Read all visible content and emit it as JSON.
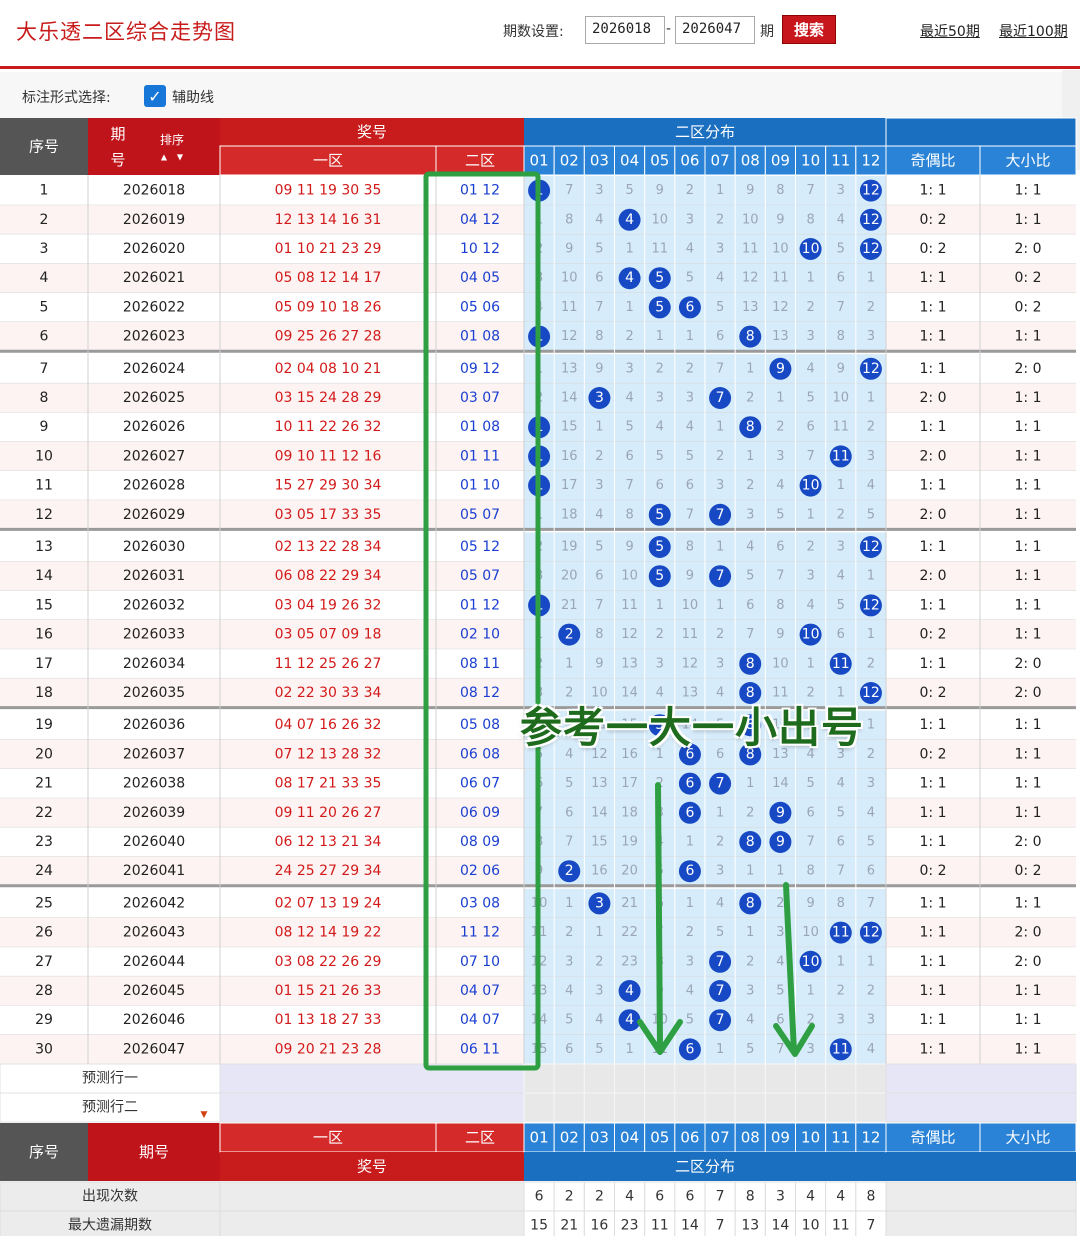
{
  "header": {
    "title": "大乐透二区综合走势图",
    "period_label": "期数设置:",
    "start_period": "2026018",
    "end_period": "2026047",
    "period_suffix": "期",
    "search_label": "搜索",
    "recent50_label": "最近50期",
    "recent100_label": "最近100期"
  },
  "mark_options": {
    "label": "标注形式选择:",
    "checkbox_label": "辅助线",
    "checked": true
  },
  "table": {
    "col_seq": "序号",
    "col_period": "期号",
    "col_period_top": "期",
    "col_period_bottom": "号",
    "sort_label": "排序",
    "col_prize": "奖号",
    "col_zone1": "一区",
    "col_zone2": "二区",
    "col_dist": "二区分布",
    "dist_numbers": [
      "01",
      "02",
      "03",
      "04",
      "05",
      "06",
      "07",
      "08",
      "09",
      "10",
      "11",
      "12"
    ],
    "col_odd_even": "奇偶比",
    "col_big_small": "大小比",
    "rows": [
      {
        "seq": "1",
        "period": "2026018",
        "zone1": "09 11 19 30 35",
        "zone2": "01 12",
        "cells": [
          "1",
          "7",
          "3",
          "5",
          "9",
          "2",
          "1",
          "9",
          "8",
          "7",
          "3",
          "12"
        ],
        "hit": [
          1,
          12
        ],
        "oe": "1: 1",
        "bs": "1: 1"
      },
      {
        "seq": "2",
        "period": "2026019",
        "zone1": "12 13 14 16 31",
        "zone2": "04 12",
        "cells": [
          "1",
          "8",
          "4",
          "4",
          "10",
          "3",
          "2",
          "10",
          "9",
          "8",
          "4",
          "12"
        ],
        "hit": [
          4,
          12
        ],
        "oe": "0: 2",
        "bs": "1: 1"
      },
      {
        "seq": "3",
        "period": "2026020",
        "zone1": "01 10 21 23 29",
        "zone2": "10 12",
        "cells": [
          "2",
          "9",
          "5",
          "1",
          "11",
          "4",
          "3",
          "11",
          "10",
          "10",
          "5",
          "12"
        ],
        "hit": [
          10,
          12
        ],
        "oe": "0: 2",
        "bs": "2: 0"
      },
      {
        "seq": "4",
        "period": "2026021",
        "zone1": "05 08 12 14 17",
        "zone2": "04 05",
        "cells": [
          "3",
          "10",
          "6",
          "4",
          "5",
          "5",
          "4",
          "12",
          "11",
          "1",
          "6",
          "1"
        ],
        "hit": [
          4,
          5
        ],
        "oe": "1: 1",
        "bs": "0: 2"
      },
      {
        "seq": "5",
        "period": "2026022",
        "zone1": "05 09 10 18 26",
        "zone2": "05 06",
        "cells": [
          "4",
          "11",
          "7",
          "1",
          "5",
          "6",
          "5",
          "13",
          "12",
          "2",
          "7",
          "2"
        ],
        "hit": [
          5,
          6
        ],
        "oe": "1: 1",
        "bs": "0: 2"
      },
      {
        "seq": "6",
        "period": "2026023",
        "zone1": "09 25 26 27 28",
        "zone2": "01 08",
        "cells": [
          "1",
          "12",
          "8",
          "2",
          "1",
          "1",
          "6",
          "8",
          "13",
          "3",
          "8",
          "3"
        ],
        "hit": [
          1,
          8
        ],
        "oe": "1: 1",
        "bs": "1: 1"
      },
      {
        "seq": "7",
        "period": "2026024",
        "zone1": "02 04 08 10 21",
        "zone2": "09 12",
        "cells": [
          "1",
          "13",
          "9",
          "3",
          "2",
          "2",
          "7",
          "1",
          "9",
          "4",
          "9",
          "12"
        ],
        "hit": [
          9,
          12
        ],
        "oe": "1: 1",
        "bs": "2: 0"
      },
      {
        "seq": "8",
        "period": "2026025",
        "zone1": "03 15 24 28 29",
        "zone2": "03 07",
        "cells": [
          "2",
          "14",
          "3",
          "4",
          "3",
          "3",
          "7",
          "2",
          "1",
          "5",
          "10",
          "1"
        ],
        "hit": [
          3,
          7
        ],
        "oe": "2: 0",
        "bs": "1: 1"
      },
      {
        "seq": "9",
        "period": "2026026",
        "zone1": "10 11 22 26 32",
        "zone2": "01 08",
        "cells": [
          "1",
          "15",
          "1",
          "5",
          "4",
          "4",
          "1",
          "8",
          "2",
          "6",
          "11",
          "2"
        ],
        "hit": [
          1,
          8
        ],
        "oe": "1: 1",
        "bs": "1: 1"
      },
      {
        "seq": "10",
        "period": "2026027",
        "zone1": "09 10 11 12 16",
        "zone2": "01 11",
        "cells": [
          "1",
          "16",
          "2",
          "6",
          "5",
          "5",
          "2",
          "1",
          "3",
          "7",
          "11",
          "3"
        ],
        "hit": [
          1,
          11
        ],
        "oe": "2: 0",
        "bs": "1: 1"
      },
      {
        "seq": "11",
        "period": "2026028",
        "zone1": "15 27 29 30 34",
        "zone2": "01 10",
        "cells": [
          "1",
          "17",
          "3",
          "7",
          "6",
          "6",
          "3",
          "2",
          "4",
          "10",
          "1",
          "4"
        ],
        "hit": [
          1,
          10
        ],
        "oe": "1: 1",
        "bs": "1: 1"
      },
      {
        "seq": "12",
        "period": "2026029",
        "zone1": "03 05 17 33 35",
        "zone2": "05 07",
        "cells": [
          "1",
          "18",
          "4",
          "8",
          "5",
          "7",
          "7",
          "3",
          "5",
          "1",
          "2",
          "5"
        ],
        "hit": [
          5,
          7
        ],
        "oe": "2: 0",
        "bs": "1: 1"
      },
      {
        "seq": "13",
        "period": "2026030",
        "zone1": "02 13 22 28 34",
        "zone2": "05 12",
        "cells": [
          "2",
          "19",
          "5",
          "9",
          "5",
          "8",
          "1",
          "4",
          "6",
          "2",
          "3",
          "12"
        ],
        "hit": [
          5,
          12
        ],
        "oe": "1: 1",
        "bs": "1: 1"
      },
      {
        "seq": "14",
        "period": "2026031",
        "zone1": "06 08 22 29 34",
        "zone2": "05 07",
        "cells": [
          "3",
          "20",
          "6",
          "10",
          "5",
          "9",
          "7",
          "5",
          "7",
          "3",
          "4",
          "1"
        ],
        "hit": [
          5,
          7
        ],
        "oe": "2: 0",
        "bs": "1: 1"
      },
      {
        "seq": "15",
        "period": "2026032",
        "zone1": "03 04 19 26 32",
        "zone2": "01 12",
        "cells": [
          "1",
          "21",
          "7",
          "11",
          "1",
          "10",
          "1",
          "6",
          "8",
          "4",
          "5",
          "12"
        ],
        "hit": [
          1,
          12
        ],
        "oe": "1: 1",
        "bs": "1: 1"
      },
      {
        "seq": "16",
        "period": "2026033",
        "zone1": "03 05 07 09 18",
        "zone2": "02 10",
        "cells": [
          "1",
          "2",
          "8",
          "12",
          "2",
          "11",
          "2",
          "7",
          "9",
          "10",
          "6",
          "1"
        ],
        "hit": [
          2,
          10
        ],
        "oe": "0: 2",
        "bs": "1: 1"
      },
      {
        "seq": "17",
        "period": "2026034",
        "zone1": "11 12 25 26 27",
        "zone2": "08 11",
        "cells": [
          "2",
          "1",
          "9",
          "13",
          "3",
          "12",
          "3",
          "8",
          "10",
          "1",
          "11",
          "2"
        ],
        "hit": [
          8,
          11
        ],
        "oe": "1: 1",
        "bs": "2: 0"
      },
      {
        "seq": "18",
        "period": "2026035",
        "zone1": "02 22 30 33 34",
        "zone2": "08 12",
        "cells": [
          "3",
          "2",
          "10",
          "14",
          "4",
          "13",
          "4",
          "8",
          "11",
          "2",
          "1",
          "12"
        ],
        "hit": [
          8,
          12
        ],
        "oe": "0: 2",
        "bs": "2: 0"
      },
      {
        "seq": "19",
        "period": "2026036",
        "zone1": "04 07 16 26 32",
        "zone2": "05 08",
        "cells": [
          "4",
          "3",
          "11",
          "15",
          "5",
          "14",
          "5",
          "8",
          "12",
          "3",
          "2",
          "1"
        ],
        "hit": [
          5,
          8
        ],
        "oe": "1: 1",
        "bs": "1: 1"
      },
      {
        "seq": "20",
        "period": "2026037",
        "zone1": "07 12 13 28 32",
        "zone2": "06 08",
        "cells": [
          "5",
          "4",
          "12",
          "16",
          "1",
          "6",
          "6",
          "8",
          "13",
          "4",
          "3",
          "2"
        ],
        "hit": [
          6,
          8
        ],
        "oe": "0: 2",
        "bs": "1: 1"
      },
      {
        "seq": "21",
        "period": "2026038",
        "zone1": "08 17 21 33 35",
        "zone2": "06 07",
        "cells": [
          "6",
          "5",
          "13",
          "17",
          "2",
          "6",
          "7",
          "1",
          "14",
          "5",
          "4",
          "3"
        ],
        "hit": [
          6,
          7
        ],
        "oe": "1: 1",
        "bs": "1: 1"
      },
      {
        "seq": "22",
        "period": "2026039",
        "zone1": "09 11 20 26 27",
        "zone2": "06 09",
        "cells": [
          "7",
          "6",
          "14",
          "18",
          "3",
          "6",
          "1",
          "2",
          "9",
          "6",
          "5",
          "4"
        ],
        "hit": [
          6,
          9
        ],
        "oe": "1: 1",
        "bs": "1: 1"
      },
      {
        "seq": "23",
        "period": "2026040",
        "zone1": "06 12 13 21 34",
        "zone2": "08 09",
        "cells": [
          "8",
          "7",
          "15",
          "19",
          "4",
          "1",
          "2",
          "8",
          "9",
          "7",
          "6",
          "5"
        ],
        "hit": [
          8,
          9
        ],
        "oe": "1: 1",
        "bs": "2: 0"
      },
      {
        "seq": "24",
        "period": "2026041",
        "zone1": "24 25 27 29 34",
        "zone2": "02 06",
        "cells": [
          "9",
          "2",
          "16",
          "20",
          "5",
          "6",
          "3",
          "1",
          "1",
          "8",
          "7",
          "6"
        ],
        "hit": [
          2,
          6
        ],
        "oe": "0: 2",
        "bs": "0: 2"
      },
      {
        "seq": "25",
        "period": "2026042",
        "zone1": "02 07 13 19 24",
        "zone2": "03 08",
        "cells": [
          "10",
          "1",
          "3",
          "21",
          "6",
          "1",
          "4",
          "8",
          "2",
          "9",
          "8",
          "7"
        ],
        "hit": [
          3,
          8
        ],
        "oe": "1: 1",
        "bs": "1: 1"
      },
      {
        "seq": "26",
        "period": "2026043",
        "zone1": "08 12 14 19 22",
        "zone2": "11 12",
        "cells": [
          "11",
          "2",
          "1",
          "22",
          "7",
          "2",
          "5",
          "1",
          "3",
          "10",
          "11",
          "12"
        ],
        "hit": [
          11,
          12
        ],
        "oe": "1: 1",
        "bs": "2: 0"
      },
      {
        "seq": "27",
        "period": "2026044",
        "zone1": "03 08 22 26 29",
        "zone2": "07 10",
        "cells": [
          "12",
          "3",
          "2",
          "23",
          "8",
          "3",
          "7",
          "2",
          "4",
          "10",
          "1",
          "1"
        ],
        "hit": [
          7,
          10
        ],
        "oe": "1: 1",
        "bs": "2: 0"
      },
      {
        "seq": "28",
        "period": "2026045",
        "zone1": "01 15 21 26 33",
        "zone2": "04 07",
        "cells": [
          "13",
          "4",
          "3",
          "4",
          "9",
          "4",
          "7",
          "3",
          "5",
          "1",
          "2",
          "2"
        ],
        "hit": [
          4,
          7
        ],
        "oe": "1: 1",
        "bs": "1: 1"
      },
      {
        "seq": "29",
        "period": "2026046",
        "zone1": "01 13 18 27 33",
        "zone2": "04 07",
        "cells": [
          "14",
          "5",
          "4",
          "4",
          "10",
          "5",
          "7",
          "4",
          "6",
          "2",
          "3",
          "3"
        ],
        "hit": [
          4,
          7
        ],
        "oe": "1: 1",
        "bs": "1: 1"
      },
      {
        "seq": "30",
        "period": "2026047",
        "zone1": "09 20 21 23 28",
        "zone2": "06 11",
        "cells": [
          "15",
          "6",
          "5",
          "1",
          "11",
          "6",
          "1",
          "5",
          "7",
          "3",
          "11",
          "4"
        ],
        "hit": [
          6,
          11
        ],
        "oe": "1: 1",
        "bs": "1: 1"
      }
    ],
    "predict1": "预测行一",
    "predict2": "预测行二",
    "appear_label": "出现次数",
    "appear_counts": [
      "6",
      "2",
      "2",
      "4",
      "6",
      "6",
      "7",
      "8",
      "3",
      "4",
      "4",
      "8"
    ],
    "maxmiss_label": "最大遗漏期数",
    "maxmiss_counts": [
      "15",
      "21",
      "16",
      "23",
      "11",
      "14",
      "7",
      "13",
      "14",
      "10",
      "11",
      "7"
    ]
  },
  "annotation": {
    "text": "参考一大一小出号",
    "color": "#2ea043"
  },
  "colors": {
    "brand_red": "#c81b1b",
    "header_blue": "#1a6fc0",
    "ball_blue": "#1749c4",
    "zone1_text": "#d31a1a",
    "zone2_text": "#1a3fd0",
    "dist_bg": "#d7ecfb"
  }
}
